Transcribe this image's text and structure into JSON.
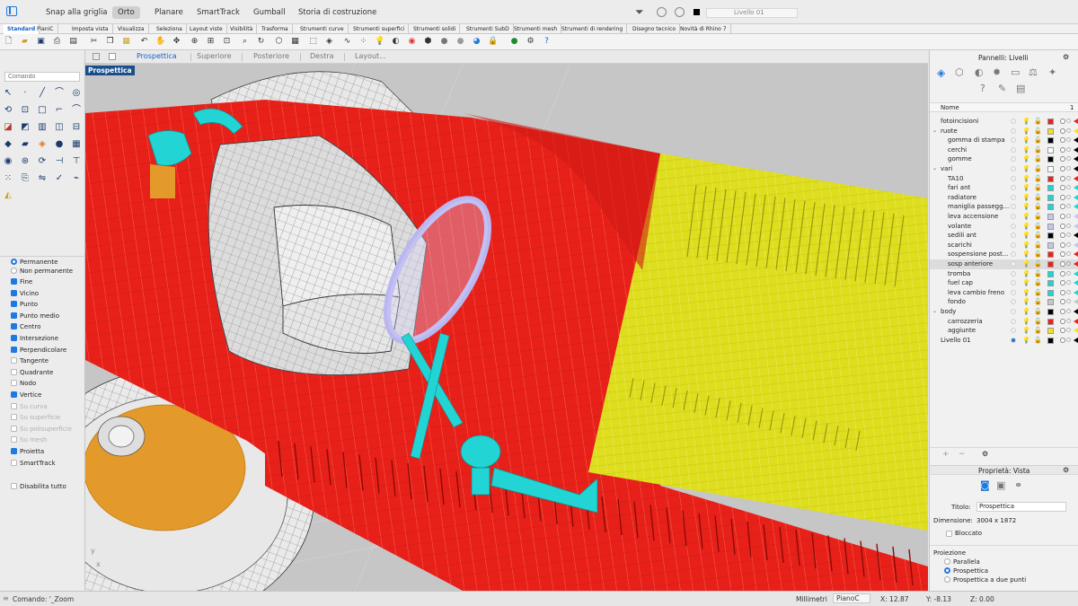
{
  "topbar": {
    "items": [
      "Snap alla griglia",
      "Orto",
      "Planare",
      "SmartTrack",
      "Gumball",
      "Storia di costruzione"
    ],
    "layer_current": "Livello 01"
  },
  "toolbar_tabs": [
    "Standard",
    "PianiC",
    "Imposta vista",
    "Visualizza",
    "Seleziona",
    "Layout viste",
    "Visibilità",
    "Trasforma",
    "Strumenti curve",
    "Strumenti superfici",
    "Strumenti solidi",
    "Strumenti SubD",
    "Strumenti mesh",
    "Strumenti di rendering",
    "Disegno tecnico",
    "Novità di Rhino 7"
  ],
  "command": {
    "placeholder": "Comando"
  },
  "osnap": {
    "permanente": "Permanente",
    "non_permanente": "Non permanente",
    "items": [
      {
        "label": "Fine",
        "on": true,
        "dim": false
      },
      {
        "label": "Vicino",
        "on": true,
        "dim": false
      },
      {
        "label": "Punto",
        "on": true,
        "dim": false
      },
      {
        "label": "Punto medio",
        "on": true,
        "dim": false
      },
      {
        "label": "Centro",
        "on": true,
        "dim": false
      },
      {
        "label": "Intersezione",
        "on": true,
        "dim": false
      },
      {
        "label": "Perpendicolare",
        "on": true,
        "dim": false
      },
      {
        "label": "Tangente",
        "on": false,
        "dim": false
      },
      {
        "label": "Quadrante",
        "on": false,
        "dim": false
      },
      {
        "label": "Nodo",
        "on": false,
        "dim": false
      },
      {
        "label": "Vertice",
        "on": true,
        "dim": false
      },
      {
        "label": "Su curva",
        "on": false,
        "dim": true
      },
      {
        "label": "Su superficie",
        "on": false,
        "dim": true
      },
      {
        "label": "Su polisuperficie",
        "on": false,
        "dim": true
      },
      {
        "label": "Su mesh",
        "on": false,
        "dim": true
      },
      {
        "label": "Proietta",
        "on": true,
        "dim": false
      },
      {
        "label": "SmartTrack",
        "on": false,
        "dim": false
      }
    ],
    "disable_all": "Disabilita tutto"
  },
  "viewtabs": [
    "Prospettica",
    "Superiore",
    "Posteriore",
    "Destra",
    "Layout..."
  ],
  "viewport": {
    "label": "Prospettica"
  },
  "layers_panel": {
    "title": "Pannelli: Livelli",
    "col_name": "Nome",
    "col_num": "1",
    "layers": [
      {
        "name": "fotoincisioni",
        "indent": 0,
        "color": "#e8241a"
      },
      {
        "name": "ruote",
        "indent": 0,
        "group": true,
        "color": "#f5e31a"
      },
      {
        "name": "gomma di stampa",
        "indent": 1,
        "color": "#000000"
      },
      {
        "name": "cerchi",
        "indent": 1,
        "color": "#ffffff"
      },
      {
        "name": "gomme",
        "indent": 1,
        "color": "#000000"
      },
      {
        "name": "vari",
        "indent": 0,
        "group": true,
        "color": "#ffffff"
      },
      {
        "name": "TA10",
        "indent": 1,
        "color": "#e8241a"
      },
      {
        "name": "fari ant",
        "indent": 1,
        "color": "#1ad6d6"
      },
      {
        "name": "radiatore",
        "indent": 1,
        "color": "#1ad6d6"
      },
      {
        "name": "maniglia passegg...",
        "indent": 1,
        "color": "#1ad6d6"
      },
      {
        "name": "leva accensione",
        "indent": 1,
        "color": "#c7c7ee"
      },
      {
        "name": "volante",
        "indent": 1,
        "color": "#c7c7ee"
      },
      {
        "name": "sedili ant",
        "indent": 1,
        "color": "#000000"
      },
      {
        "name": "scarichi",
        "indent": 1,
        "color": "#c7c7ee"
      },
      {
        "name": "sospensione post...",
        "indent": 1,
        "color": "#e8241a"
      },
      {
        "name": "sosp anteriore",
        "indent": 1,
        "color": "#e8241a",
        "sel": true
      },
      {
        "name": "tromba",
        "indent": 1,
        "color": "#1ad6d6"
      },
      {
        "name": "fuel cap",
        "indent": 1,
        "color": "#1ad6d6"
      },
      {
        "name": "leva cambio freno",
        "indent": 1,
        "color": "#1ad6d6"
      },
      {
        "name": "fondo",
        "indent": 1,
        "color": "#c7c7c7"
      },
      {
        "name": "body",
        "indent": 0,
        "group": true,
        "color": "#000000"
      },
      {
        "name": "carrozzeria",
        "indent": 1,
        "color": "#e8241a"
      },
      {
        "name": "aggiunte",
        "indent": 1,
        "color": "#f5e31a"
      },
      {
        "name": "Livello 01",
        "indent": 0,
        "color": "#000000",
        "current": true
      }
    ]
  },
  "properties_panel": {
    "title": "Proprietà: Vista",
    "titolo_label": "Titolo:",
    "titolo_value": "Prospettica",
    "dim_label": "Dimensione:",
    "dim_value": "3004 x 1872",
    "bloccato": "Bloccato",
    "proiezione": "Proiezione",
    "proj_options": [
      {
        "label": "Parallela",
        "on": false
      },
      {
        "label": "Prospettica",
        "on": true
      },
      {
        "label": "Prospettica a due punti",
        "on": false
      }
    ]
  },
  "statusbar": {
    "command": "Comando: '_Zoom",
    "units": "Millimetri",
    "cplane": "PianoC",
    "x": "X: 12.87",
    "y": "Y: -8.13",
    "z": "Z: 0.00"
  },
  "colors": {
    "body": "#e8201a",
    "hood": "#dede1e",
    "parts": "#22d4d4",
    "accent": "#1f7ae0"
  }
}
